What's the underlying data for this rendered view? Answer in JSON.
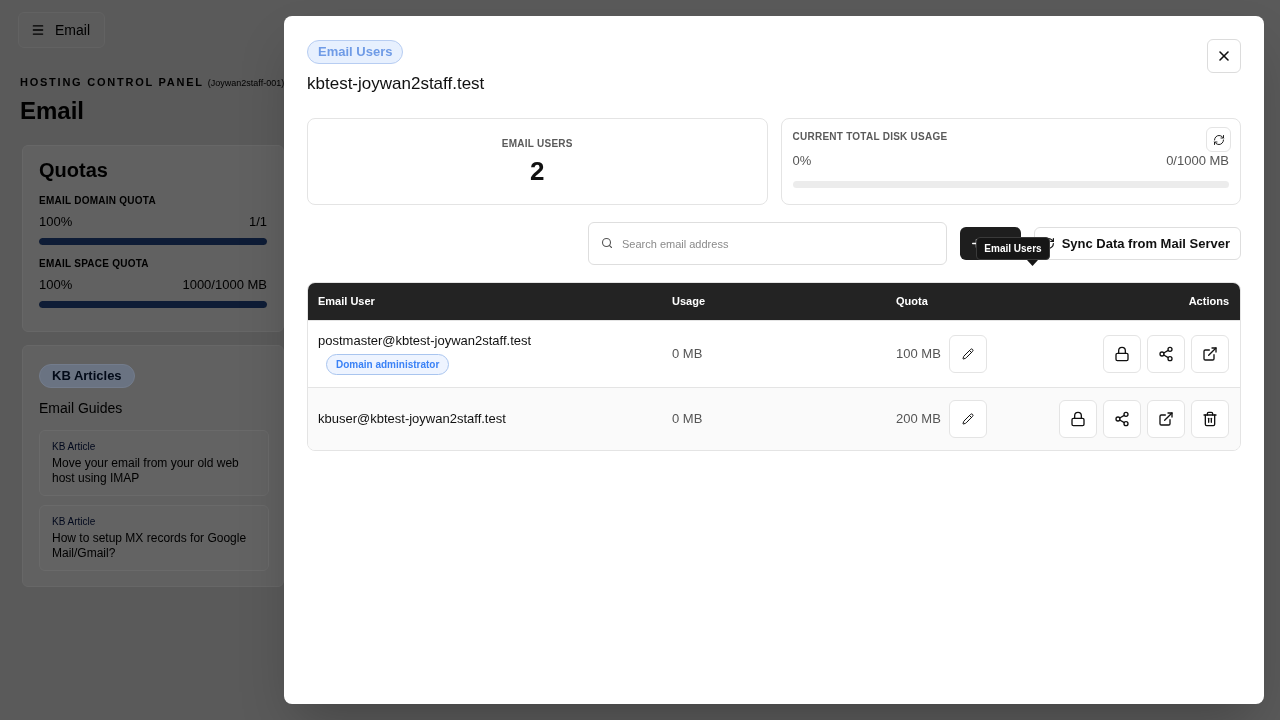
{
  "page": {
    "menu_button": {
      "label": "Email"
    },
    "eyebrow": "HOSTING CONTROL PANEL",
    "account": "(Joywan2staff-001)",
    "title": "Email",
    "quotas": {
      "title": "Quotas",
      "items": [
        {
          "label": "EMAIL DOMAIN QUOTA",
          "percent": "100%",
          "reading": "1/1",
          "level": 1
        },
        {
          "label": "EMAIL SPACE QUOTA",
          "percent": "100%",
          "reading": "1000/1000 MB",
          "level": 1
        }
      ]
    },
    "kb": {
      "badge": "KB Articles",
      "title": "Email Guides",
      "articles": [
        {
          "tag": "KB Article",
          "title": "Move your email from your old web host using IMAP"
        },
        {
          "tag": "KB Article",
          "title": "How to setup MX records for Google Mail/Gmail?"
        }
      ]
    }
  },
  "dialog": {
    "badge": "Email Users",
    "title": "kbtest-joywan2staff.test",
    "stats": [
      {
        "kind": "count",
        "label": "EMAIL USERS",
        "value": "2"
      },
      {
        "kind": "usage",
        "label": "CURRENT TOTAL DISK USAGE",
        "percent": "0%",
        "reading": "0/1000 MB",
        "level": 0
      }
    ],
    "search": {
      "placeholder": "Search email address"
    },
    "sync_button": {
      "label": "Sync Data from Mail Server"
    },
    "tooltip": {
      "text": "Email Users"
    },
    "table": {
      "columns": [
        "Email User",
        "Usage",
        "Quota",
        "Actions"
      ],
      "rows": [
        {
          "email": "postmaster@kbtest-joywan2staff.test",
          "badge": "Domain administrator",
          "usage": "0 MB",
          "quota": "100 MB",
          "actions": [
            {
              "kind": "lock"
            },
            {
              "kind": "share"
            },
            {
              "kind": "external"
            }
          ]
        },
        {
          "email": "kbuser@kbtest-joywan2staff.test",
          "usage": "0 MB",
          "quota": "200 MB",
          "actions": [
            {
              "kind": "lock"
            },
            {
              "kind": "share"
            },
            {
              "kind": "external"
            },
            {
              "kind": "delete"
            }
          ]
        }
      ]
    }
  }
}
